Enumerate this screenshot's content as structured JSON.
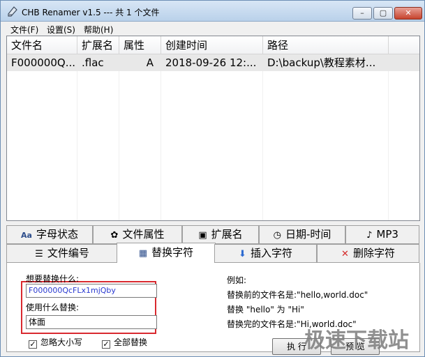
{
  "window": {
    "title": "CHB Renamer v1.5 --- 共 1 个文件",
    "controls": {
      "minimize": "–",
      "maximize": "▢",
      "close": "✕"
    }
  },
  "menu": [
    "文件(F)",
    "设置(S)",
    "帮助(H)"
  ],
  "list": {
    "columns": [
      "文件名",
      "扩展名",
      "属性",
      "创建时间",
      "路径"
    ],
    "rows": [
      [
        "F000000Q...",
        ".flac",
        "A",
        "2018-09-26 12:...",
        "D:\\backup\\教程素材..."
      ]
    ]
  },
  "tabs": {
    "row1": [
      {
        "icon": "Aa",
        "label": "字母状态"
      },
      {
        "icon": "✿",
        "label": "文件属性"
      },
      {
        "icon": "▣",
        "label": "扩展名"
      },
      {
        "icon": "◷",
        "label": "日期-时间"
      },
      {
        "icon": "♪",
        "label": "MP3"
      }
    ],
    "row2": [
      {
        "icon": "☰",
        "label": "文件编号"
      },
      {
        "icon": "▦",
        "label": "替换字符"
      },
      {
        "icon": "⬇",
        "label": "插入字符"
      },
      {
        "icon": "✕",
        "label": "删除字符"
      }
    ],
    "active": "替换字符"
  },
  "replace_panel": {
    "find_label": "想要替换什么:",
    "find_value": "F000000QcFLx1mjQby",
    "replace_label": "使用什么替换:",
    "replace_value": "体面",
    "ignore_case": "忽略大小写",
    "replace_all": "全部替换",
    "checkmark": "✓"
  },
  "example": {
    "title": "例如:",
    "line1": "替换前的文件名是:\"hello,world.doc\"",
    "line2": "替换 \"hello\" 为 \"Hi\"",
    "line3": "替换完的文件名是:\"Hi,world.doc\""
  },
  "buttons": {
    "execute": "执 行",
    "preview": "预 览"
  },
  "watermark": "极速下载站",
  "colors": {
    "highlight_box": "#d9292f",
    "delete_icon": "#d42a2a",
    "insert_icon": "#2d6bd1"
  }
}
